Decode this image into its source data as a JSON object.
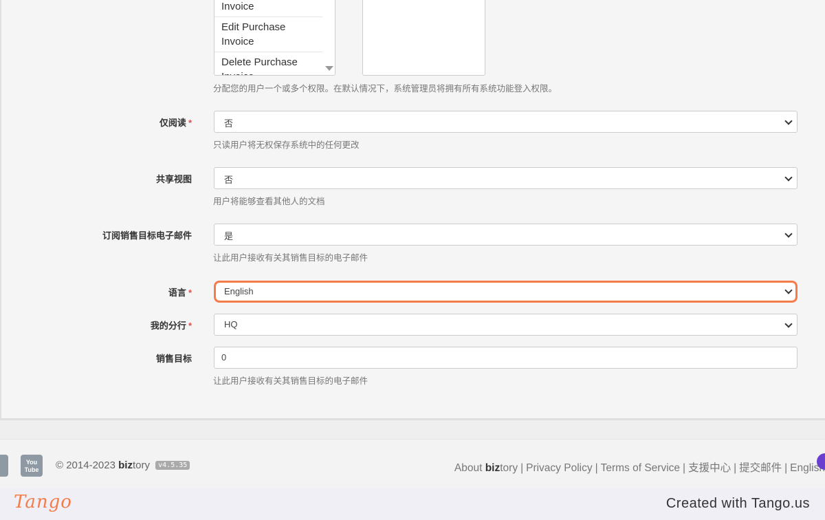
{
  "permissions": {
    "items": [
      "Invoice",
      "Edit Purchase Invoice",
      "Delete Purchase Invoice"
    ],
    "help": "分配您的用户一个或多个权限。在默认情况下，系统管理员将拥有所有系统功能登入权限。"
  },
  "fields": {
    "readonly": {
      "label": "仅阅读",
      "required": "*",
      "value": "否",
      "help": "只读用户将无权保存系统中的任何更改"
    },
    "shared_view": {
      "label": "共享视图",
      "value": "否",
      "help": "用户将能够查看其他人的文档"
    },
    "subscribe_sales": {
      "label": "订阅销售目标电子邮件",
      "value": "是",
      "help": "让此用户接收有关其销售目标的电子邮件"
    },
    "language": {
      "label": "语言",
      "required": "*",
      "value": "English"
    },
    "branch": {
      "label": "我的分行",
      "required": "*",
      "value": "HQ"
    },
    "sales_target": {
      "label": "销售目标",
      "value": "0",
      "help": "让此用户接收有关其销售目标的电子邮件"
    }
  },
  "footer": {
    "youtube_label": "You Tube",
    "copyright_prefix": "© 2014-2023 ",
    "brand_bold": "biz",
    "brand_rest": "tory",
    "version": "v4.5.35",
    "links": {
      "about_prefix": "About ",
      "about_bold": "biz",
      "about_rest": "tory",
      "privacy": "Privacy Policy",
      "terms": "Terms of Service",
      "support": "支援中心",
      "submit_email": "提交邮件",
      "language": "English",
      "separator": "|"
    }
  },
  "tango": {
    "logo": "Tango",
    "credit": "Created with Tango.us"
  },
  "colors": {
    "highlight": "#f47c48",
    "required": "#d9534f"
  }
}
